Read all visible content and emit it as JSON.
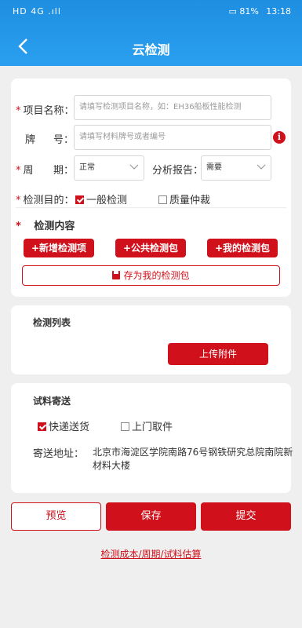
{
  "status_bar": {
    "left": "HD 4G .ıll",
    "battery": "81%",
    "time": "13:18"
  },
  "header": {
    "title": "云检测",
    "back_icon": "chevron-left-icon"
  },
  "form": {
    "project_name": {
      "label": "项目名称：",
      "placeholder": "请填写检测项目名称，如：EH36船板性能检测"
    },
    "grade": {
      "label_a": "牌",
      "label_b": "号：",
      "placeholder": "请填写材料牌号或者编号",
      "info": "i"
    },
    "period": {
      "label_a": "周",
      "label_b": "期：",
      "value": "正常"
    },
    "report": {
      "label": "分析报告：",
      "value": "需要"
    },
    "purpose": {
      "label": "检测目的：",
      "options": [
        {
          "label": "一般检测",
          "checked": true
        },
        {
          "label": "质量仲裁",
          "checked": false
        }
      ]
    },
    "content": {
      "label": "检测内容",
      "add_item": "+新增检测项",
      "public_pkg": "+公共检测包",
      "my_pkg": "+我的检测包",
      "save_pkg": "存为我的检测包"
    },
    "required_mark": "*"
  },
  "list": {
    "title": "检测列表",
    "upload": "上传附件"
  },
  "shipping": {
    "title": "试料寄送",
    "options": [
      {
        "label": "快递送货",
        "checked": true
      },
      {
        "label": "上门取件",
        "checked": false
      }
    ],
    "address_label": "寄送地址：",
    "address_line1": "北京市海淀区学院南路76号钢铁研究总院南院新",
    "address_line2": "材料大楼"
  },
  "actions": {
    "preview": "预览",
    "save": "保存",
    "submit": "提交"
  },
  "footer_link": "检测成本/周期/试料估算",
  "colors": {
    "accent": "#d0101b",
    "header": "#2a9ff0"
  }
}
